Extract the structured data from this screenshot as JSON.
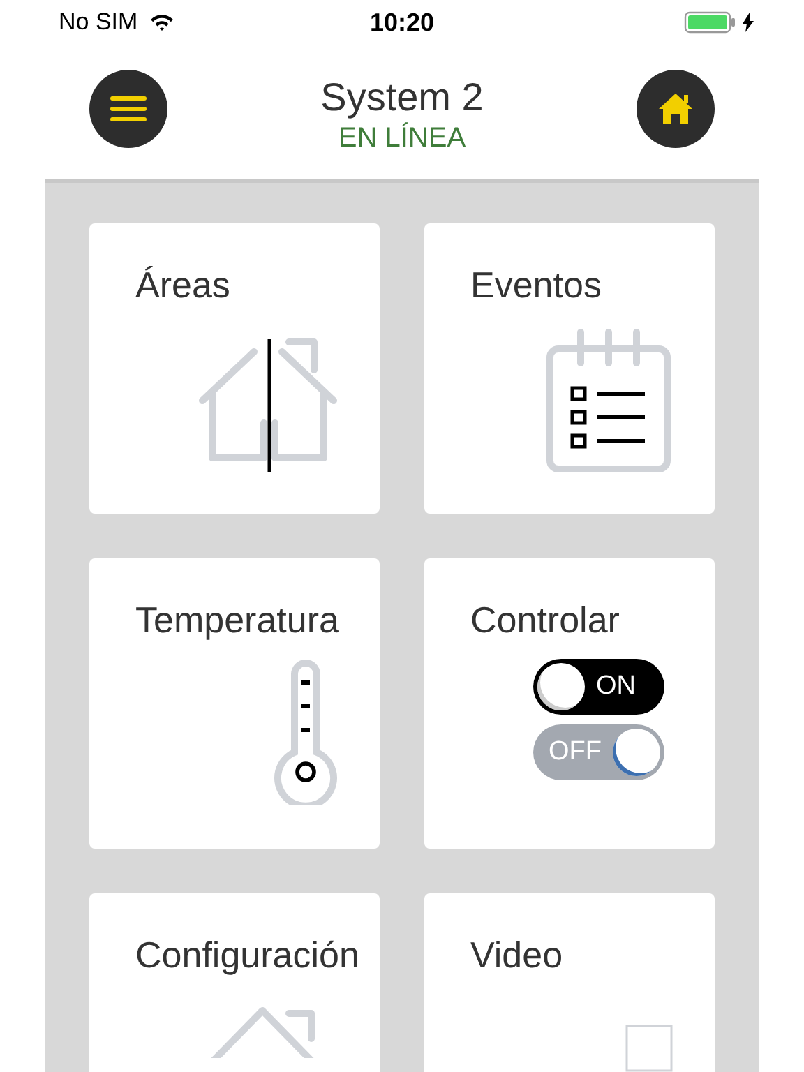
{
  "status_bar": {
    "carrier": "No SIM",
    "time": "10:20",
    "charging": true
  },
  "header": {
    "title": "System 2",
    "status": "EN LÍNEA"
  },
  "tiles": [
    {
      "kind": "areas",
      "label": "Áreas"
    },
    {
      "kind": "events",
      "label": "Eventos"
    },
    {
      "kind": "temperature",
      "label": "Temperatura"
    },
    {
      "kind": "control",
      "label": "Controlar",
      "toggles": [
        {
          "label": "ON",
          "kind": "dark"
        },
        {
          "label": "OFF",
          "kind": "light"
        }
      ]
    },
    {
      "kind": "settings",
      "label": "Configuración"
    },
    {
      "kind": "video",
      "label": "Video"
    }
  ]
}
